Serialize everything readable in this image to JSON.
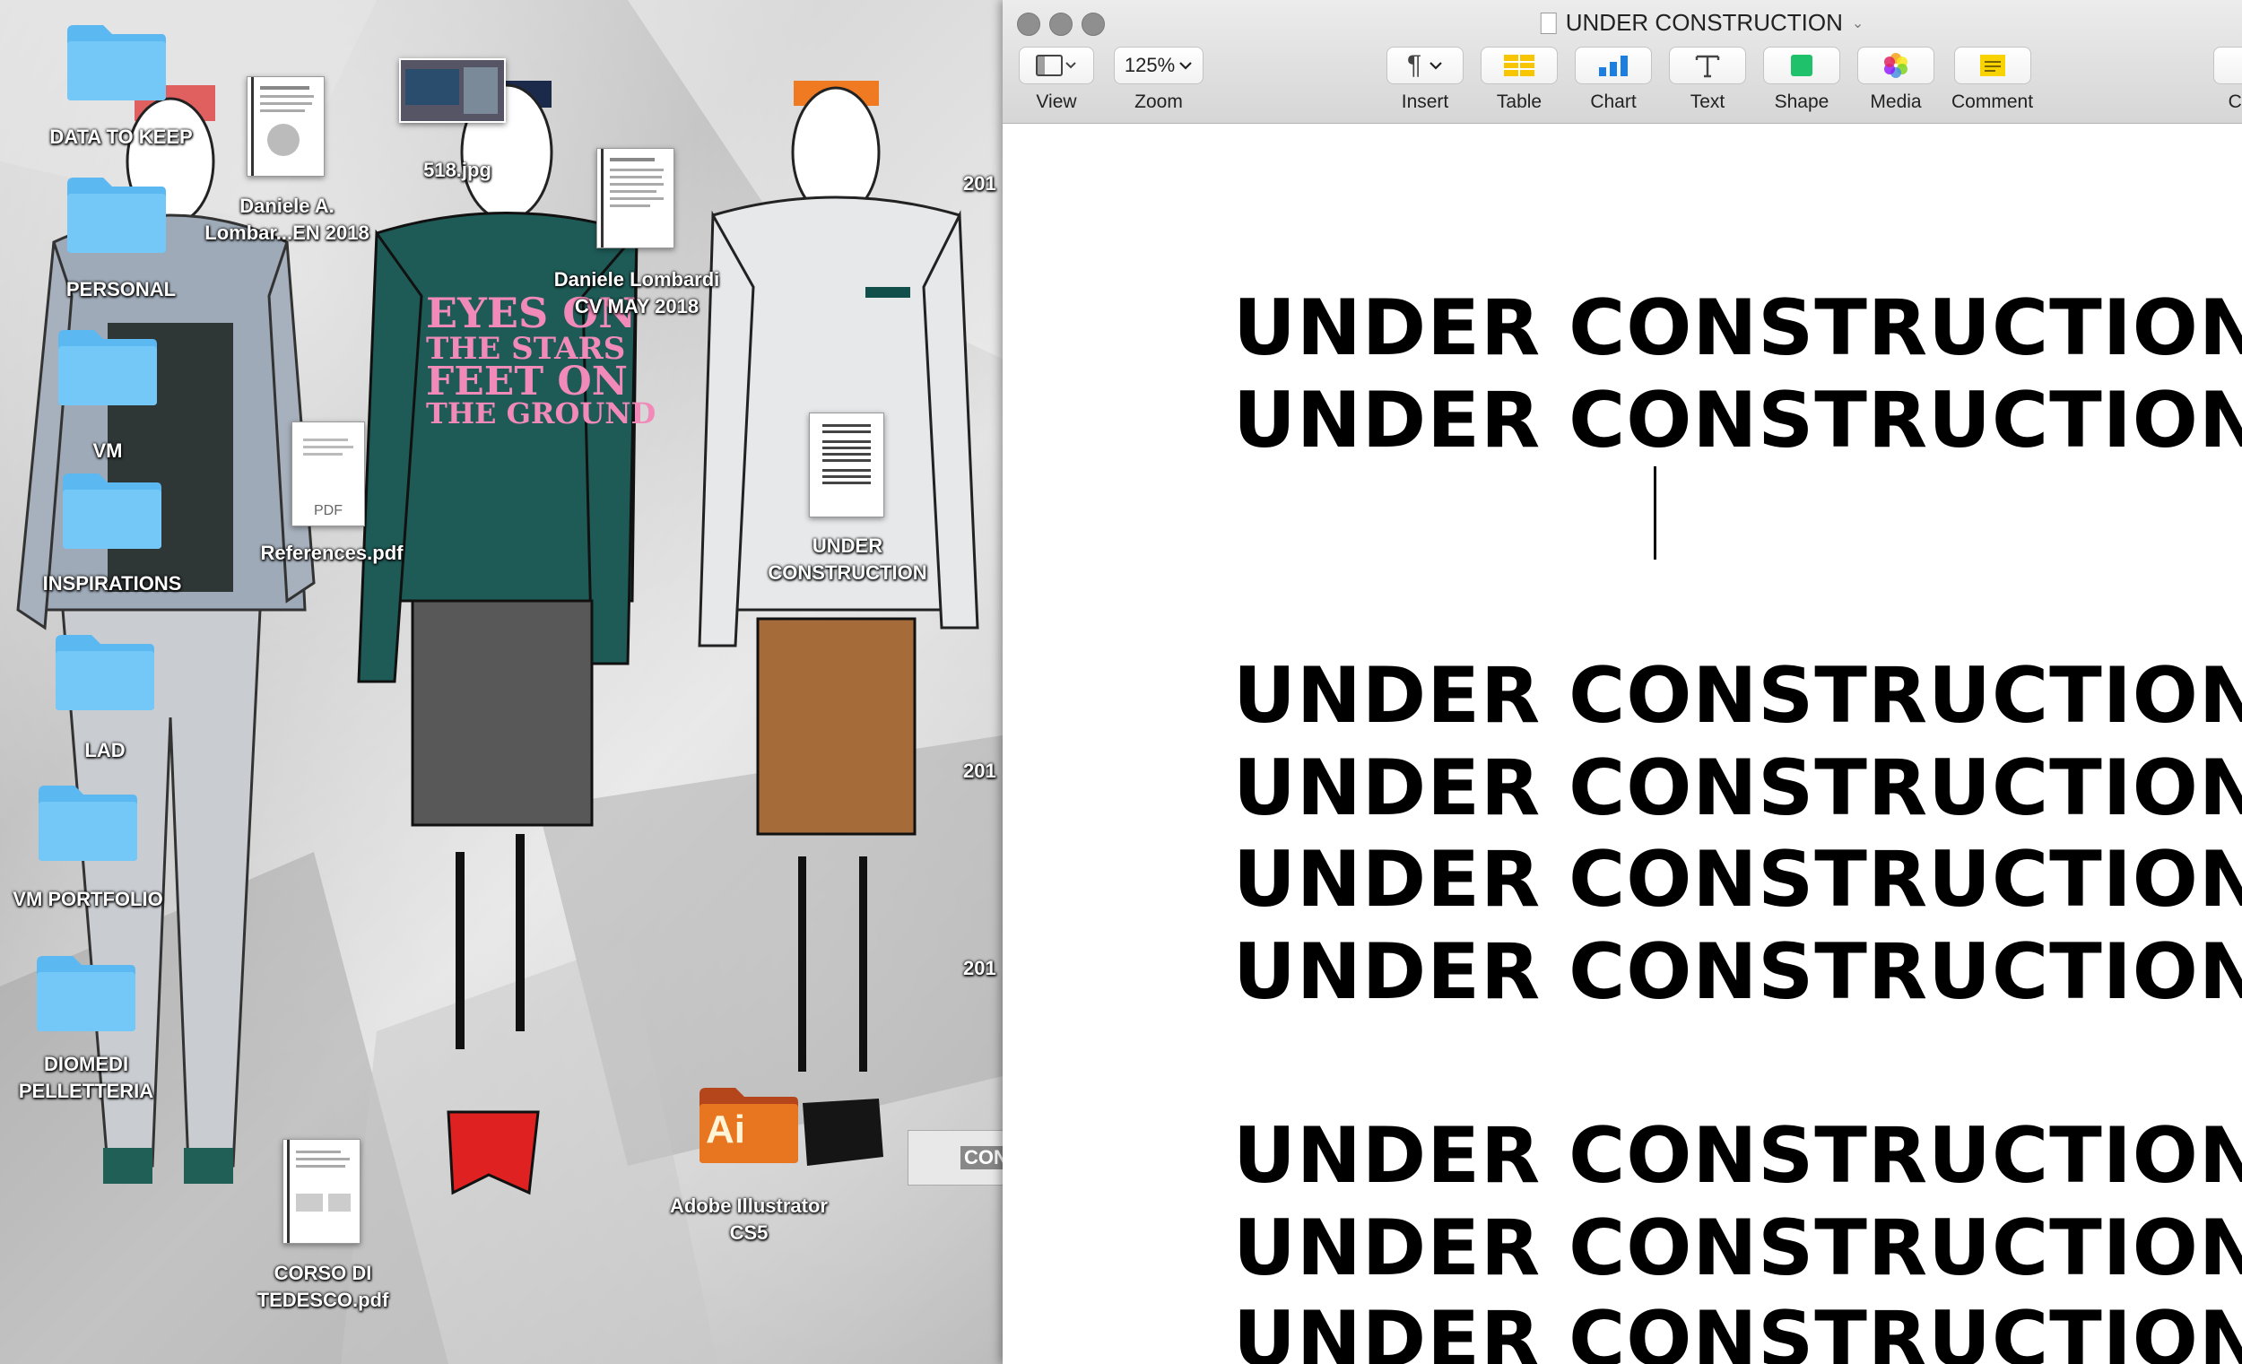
{
  "desktop": {
    "icons": [
      {
        "label": "DATA TO KEEP",
        "type": "folder"
      },
      {
        "label": "PERSONAL",
        "type": "folder"
      },
      {
        "label": "VM",
        "type": "folder"
      },
      {
        "label": "INSPIRATIONS",
        "type": "folder"
      },
      {
        "label": "LAD",
        "type": "folder"
      },
      {
        "label": "VM PORTFOLIO",
        "type": "folder"
      },
      {
        "label": "DIOMEDI\nPELLETTERIA",
        "type": "folder"
      },
      {
        "label": "Daniele A.\nLombar...EN 2018",
        "type": "document"
      },
      {
        "label": "518.jpg",
        "type": "image"
      },
      {
        "label": "Daniele Lombardi\nCV MAY 2018",
        "type": "document"
      },
      {
        "label": "References.pdf",
        "type": "pdf",
        "badge": "PDF"
      },
      {
        "label": "UNDER\nCONSTRUCTION",
        "type": "document"
      },
      {
        "label": "CORSO DI\nTEDESCO.pdf",
        "type": "pdf"
      },
      {
        "label": "Adobe Illustrator\nCS5",
        "type": "app-folder",
        "badge": "Ai"
      }
    ],
    "artwork_text": "EYES ON\nTHE STARS\nFEET ON\nTHE GROUND",
    "partial_labels": [
      "201",
      "201",
      "201",
      "CON"
    ]
  },
  "window": {
    "title": "UNDER CONSTRUCTION",
    "toolbar": {
      "view": "View",
      "zoom_value": "125%",
      "zoom": "Zoom",
      "insert": "Insert",
      "table": "Table",
      "chart": "Chart",
      "text": "Text",
      "shape": "Shape",
      "media": "Media",
      "comment": "Comment",
      "overflow": "Co"
    },
    "colors": {
      "table": "#f7c600",
      "chart": "#1a7fe0",
      "shape": "#1fc16b",
      "comment": "#f9d300"
    },
    "document": {
      "lines": [
        "UNDER CONSTRUCTION",
        "UNDER CONSTRUCTION",
        "UNDER CONSTRUCTION",
        "UNDER CONSTRUCTION",
        "UNDER CONSTRUCTION",
        "UNDER CONSTRUCTION",
        "UNDER CONSTRUCTION",
        "UNDER CONSTRUCTION",
        "UNDER CONSTRUCTION"
      ]
    }
  }
}
